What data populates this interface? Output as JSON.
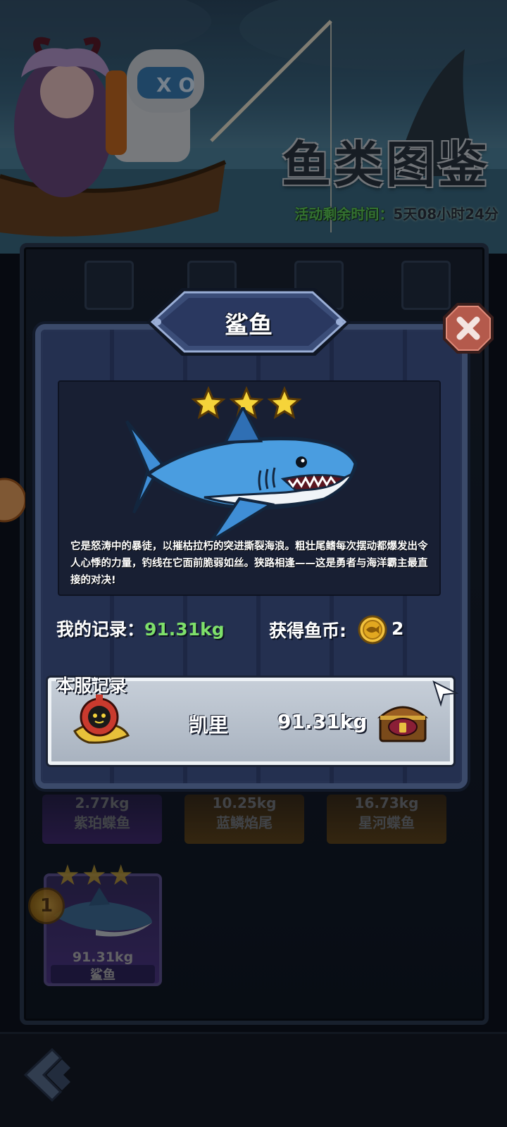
{
  "banner": {
    "title": "鱼类图鉴",
    "event_timer_label": "活动剩余时间：",
    "event_timer_value": "5天08小时24分"
  },
  "modal": {
    "fish_name": "鲨鱼",
    "stars": 3,
    "description": "它是怒涛中的暴徒，以摧枯拉朽的突进撕裂海浪。粗壮尾鳍每次摆动都爆发出令人心悸的力量，钓线在它面前脆弱如丝。狭路相逢——这是勇者与海洋霸主最直接的对决!",
    "my_record_label": "我的记录：",
    "my_record_value": "91.31kg",
    "coins_label": "获得鱼币:",
    "coins_value": "2",
    "server_record_label": "本服记录",
    "server_player": "凯里",
    "server_weight": "91.31kg"
  },
  "collection": {
    "cards": [
      {
        "weight": "2.77kg",
        "name": "紫珀蝶鱼"
      },
      {
        "weight": "10.25kg",
        "name": "蓝鳞焰尾"
      },
      {
        "weight": "16.73kg",
        "name": "星河蝶鱼"
      }
    ],
    "featured": {
      "weight": "91.31kg",
      "name": "鲨鱼",
      "rank": "1"
    }
  },
  "colors": {
    "accent_green": "#7ee06a",
    "timer_green": "#5fd05a",
    "panel": "#1f2940",
    "star": "#f5d43a"
  }
}
